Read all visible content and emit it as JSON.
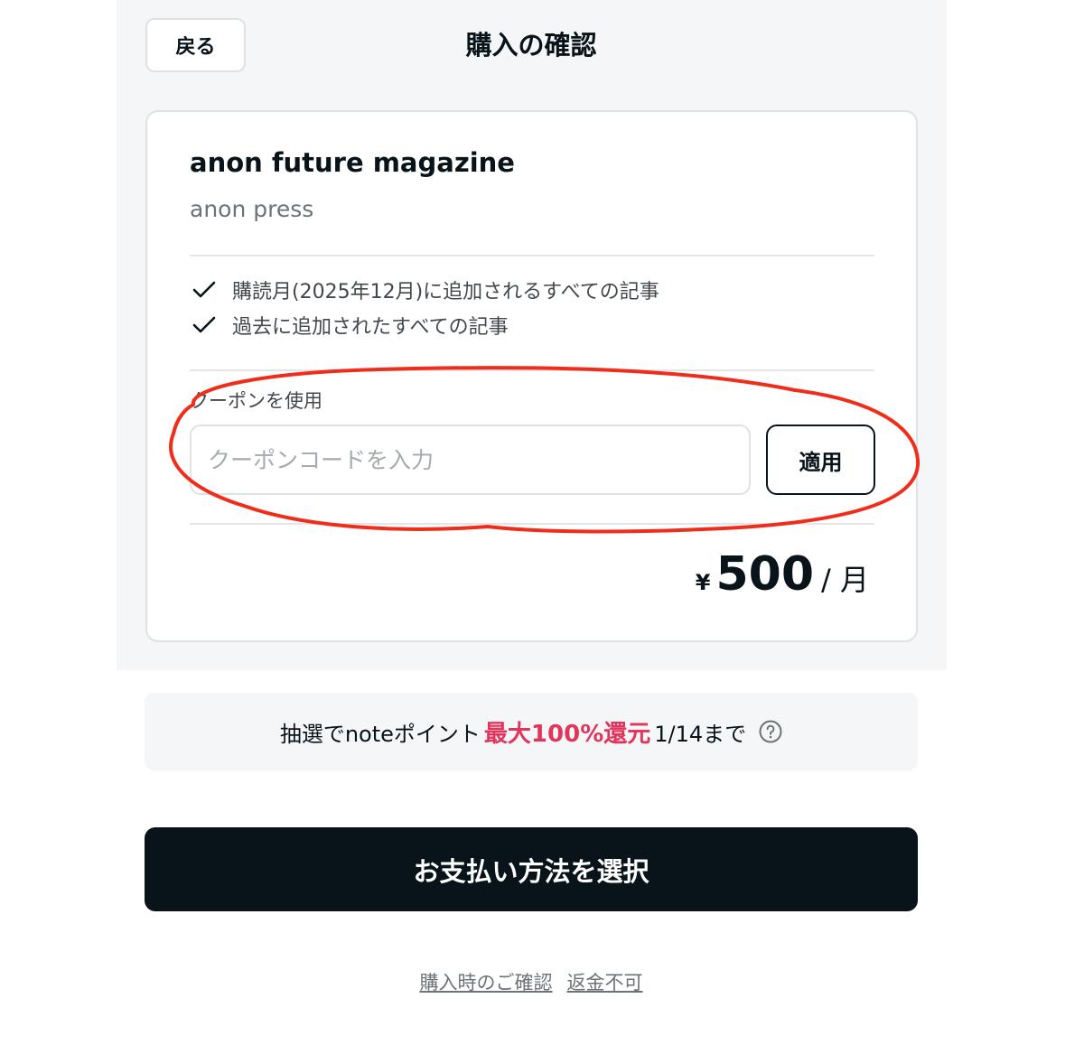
{
  "header": {
    "back_label": "戻る",
    "title": "購入の確認"
  },
  "product": {
    "title": "anon future magazine",
    "publisher": "anon press"
  },
  "features": [
    {
      "icon": "check-icon",
      "text": "購読月(2025年12月)に追加されるすべての記事"
    },
    {
      "icon": "check-icon",
      "text": "過去に追加されたすべての記事"
    }
  ],
  "coupon": {
    "label": "クーポンを使用",
    "placeholder": "クーポンコードを入力",
    "value": "",
    "apply_label": "適用"
  },
  "price": {
    "currency": "¥",
    "amount": "500",
    "period": "/ 月"
  },
  "promo": {
    "text_before": "抽選でnoteポイント",
    "highlight": "最大100%還元",
    "text_after": "1/14まで",
    "highlight_color": "#e0355c",
    "help_icon": "question-circle-icon"
  },
  "pay_button": {
    "label": "お支払い方法を選択"
  },
  "footer": {
    "links": [
      "購入時のご確認",
      "返金不可"
    ]
  },
  "annotation": {
    "shape": "hand-drawn-ellipse",
    "color": "#f02d1a"
  }
}
